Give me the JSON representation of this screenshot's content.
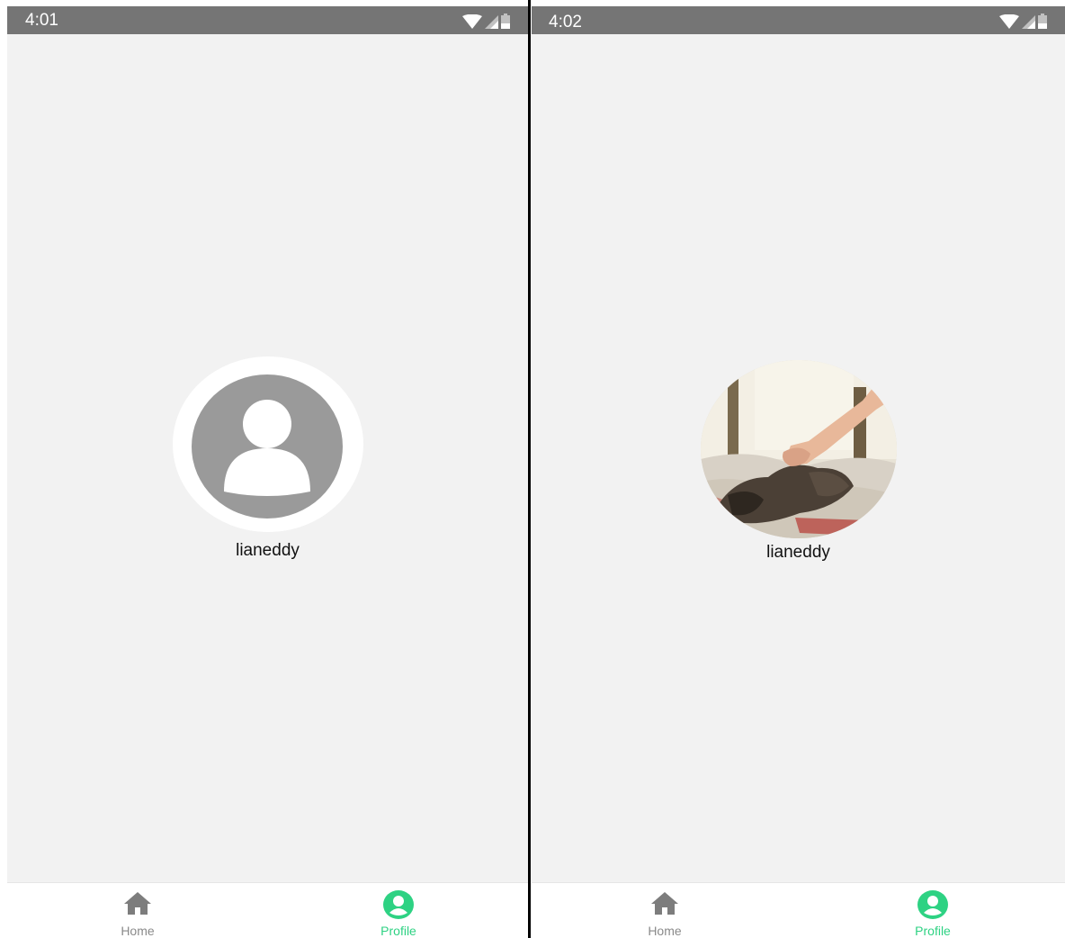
{
  "screens": [
    {
      "status_time": "4:01",
      "username": "lianeddy",
      "avatar": "placeholder-person-icon",
      "tabs": [
        {
          "label": "Home",
          "icon": "home-icon",
          "active": false
        },
        {
          "label": "Profile",
          "icon": "account-circle-icon",
          "active": true
        }
      ]
    },
    {
      "status_time": "4:02",
      "username": "lianeddy",
      "avatar": "profile-photo-cat",
      "tabs": [
        {
          "label": "Home",
          "icon": "home-icon",
          "active": false
        },
        {
          "label": "Profile",
          "icon": "account-circle-icon",
          "active": true
        }
      ]
    }
  ],
  "colors": {
    "status_bar": "#757575",
    "background": "#f2f2f2",
    "active_tab": "#2ed283",
    "inactive_tab": "#8a8a8a",
    "avatar_placeholder": "#9a9a9a"
  }
}
